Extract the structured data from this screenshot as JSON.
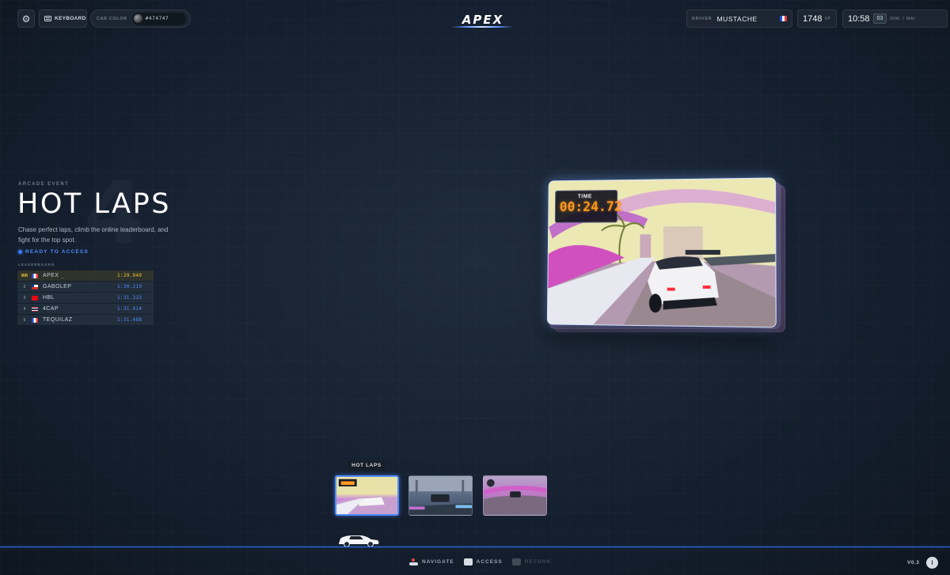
{
  "topbar": {
    "settings_icon": "gear-icon",
    "keyboard_label": "KEYBOARD",
    "car_color_label": "CAR COLOR",
    "car_color_value": "#474747",
    "logo": "APEX",
    "driver_label": "DRIVER",
    "driver_name": "MUSTACHE",
    "xp_value": "1748",
    "xp_unit": "XP",
    "clock_time": "10:58",
    "clock_day": "03",
    "clock_date": "DIM. / MAI"
  },
  "event": {
    "ghost_number": "4",
    "kicker": "ARCADE EVENT",
    "title": "HOT LAPS",
    "description": "Chase perfect laps, climb the online leaderboard, and fight for the top spot.",
    "status": "READY TO ACCESS"
  },
  "leaderboard": {
    "title": "LEADERBOARD",
    "rows": [
      {
        "rank": "WR",
        "flag": "fr",
        "name": "APEX",
        "extra": "_",
        "time": "1:29.949"
      },
      {
        "rank": "2",
        "flag": "cl",
        "name": "GABOLEP",
        "extra": "",
        "time": "1:30.219"
      },
      {
        "rank": "3",
        "flag": "tr",
        "name": "HBL",
        "extra": "",
        "time": "1:31.333"
      },
      {
        "rank": "4",
        "flag": "th",
        "name": "4CAP",
        "extra": "",
        "time": "1:31.414"
      },
      {
        "rank": "5",
        "flag": "fr",
        "name": "TEQUILAZ",
        "extra": "",
        "time": "1:31.488"
      }
    ]
  },
  "preview": {
    "timer_label": "TIME",
    "timer_value": "00:24.72"
  },
  "carousel": {
    "active_label": "HOT LAPS"
  },
  "footer": {
    "navigate": "NAVIGATE",
    "access": "ACCESS",
    "return": "RETURN",
    "version": "V0.3",
    "info": "i"
  },
  "colors": {
    "accent": "#4f8cff",
    "gold": "#f3c83a",
    "timer": "#ff9a1f"
  }
}
